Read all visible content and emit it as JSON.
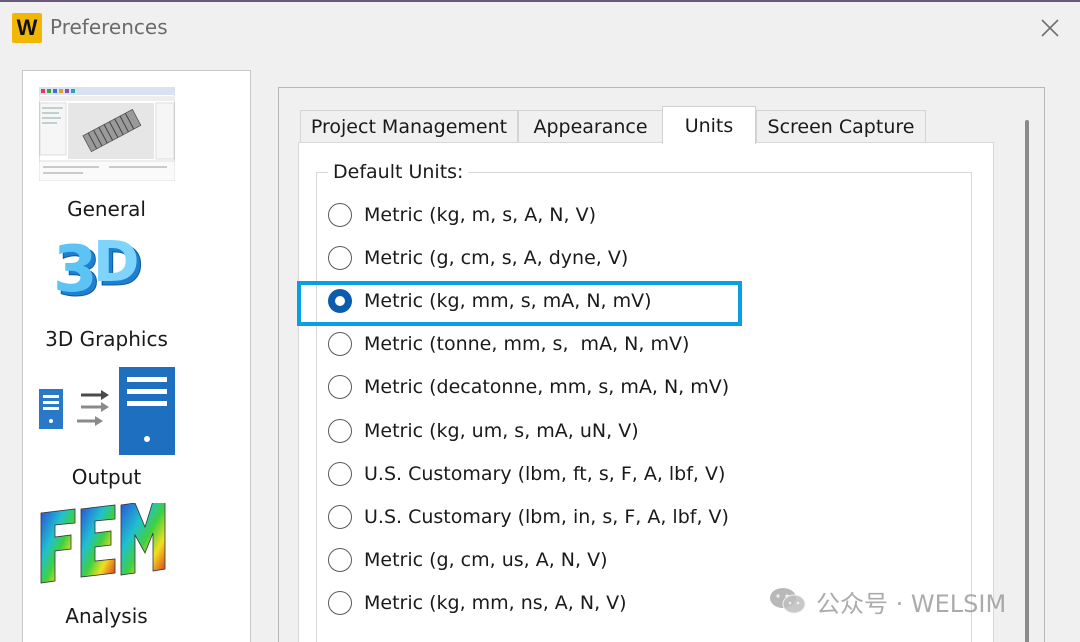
{
  "window": {
    "app_icon_letter": "W",
    "title": "Preferences",
    "close_glyph": "✕"
  },
  "categories": [
    {
      "label": "General",
      "icon": "general-screenshot-icon"
    },
    {
      "label": "3D Graphics",
      "icon": "3d-graphics-icon"
    },
    {
      "label": "Output",
      "icon": "output-icon"
    },
    {
      "label": "Analysis",
      "icon": "fem-analysis-icon"
    }
  ],
  "tabs": [
    {
      "label": "Project Management",
      "active": false
    },
    {
      "label": "Appearance",
      "active": false
    },
    {
      "label": "Units",
      "active": true
    },
    {
      "label": "Screen Capture",
      "active": false
    }
  ],
  "units_group": {
    "title": "Default Units:",
    "options": [
      {
        "label": "Metric (kg, m, s, A, N, V)",
        "checked": false
      },
      {
        "label": "Metric (g, cm, s, A, dyne, V)",
        "checked": false
      },
      {
        "label": "Metric (kg, mm, s, mA, N, mV)",
        "checked": true
      },
      {
        "label": "Metric (tonne, mm, s,  mA, N, mV)",
        "checked": false
      },
      {
        "label": "Metric (decatonne, mm, s, mA, N, mV)",
        "checked": false
      },
      {
        "label": "Metric (kg, um, s, mA, uN, V)",
        "checked": false
      },
      {
        "label": "U.S. Customary (lbm, ft, s, F, A, lbf, V)",
        "checked": false
      },
      {
        "label": "U.S. Customary (lbm, in, s, F, A, lbf, V)",
        "checked": false
      },
      {
        "label": "Metric (g, cm, us, A, N, V)",
        "checked": false
      },
      {
        "label": "Metric (kg, mm, ns, A, N, V)",
        "checked": false
      }
    ]
  },
  "watermark": {
    "text": "公众号 · WELSIM",
    "icon": "wechat-icon"
  },
  "colors": {
    "app_icon_bg": "#f2b705",
    "selected_radio": "#0b5cad",
    "highlight_box": "#0a9fe0"
  }
}
